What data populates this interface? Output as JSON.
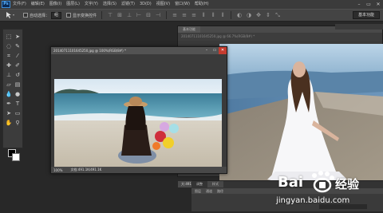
{
  "app": {
    "logo": "Ps"
  },
  "menu": [
    "文件(F)",
    "编辑(E)",
    "图像(I)",
    "图层(L)",
    "文字(Y)",
    "选择(S)",
    "滤镜(T)",
    "3D(D)",
    "视图(V)",
    "窗口(W)",
    "帮助(H)"
  ],
  "window_controls": {
    "minimize": "–",
    "maximize": "▭",
    "close": "✕"
  },
  "options": {
    "auto_select_label": "自动选择：",
    "auto_select_value": "组",
    "show_transform_label": "显示变换控件",
    "workspace": "基本功能"
  },
  "doc_front": {
    "title": "20140711101645250.jpg @ 100%(RGB/8#) *",
    "zoom": "100%",
    "doc_info": "文档:491.1K/491.1K"
  },
  "doc_back": {
    "tab": "基本功能",
    "title": "20140711101645250.jpg @ 66.7%(RGB/8#) *",
    "status": "大:491.1K/761.1K"
  },
  "panel_bottom": {
    "tabs": [
      "调整",
      "样式"
    ],
    "rows": [
      "图层",
      "通道",
      "路径"
    ]
  },
  "watermark": {
    "brand": "Bai",
    "brand_suffix": "经验",
    "url": "jingyan.baidu.com"
  }
}
